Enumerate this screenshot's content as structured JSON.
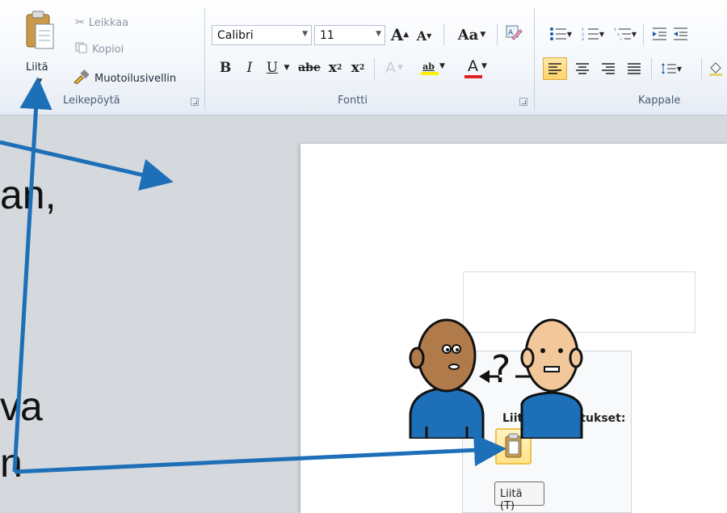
{
  "ribbon": {
    "clipboard": {
      "paste_label": "Liitä",
      "cut_label": "Leikkaa",
      "copy_label": "Kopioi",
      "format_painter_label": "Muotoilusivellin",
      "caption": "Leikepöytä"
    },
    "font": {
      "font_name": "Calibri",
      "font_size": "11",
      "caption": "Fontti",
      "grow_label": "A",
      "shrink_label": "A",
      "case_label": "Aa",
      "bold_label": "B",
      "italic_label": "I",
      "underline_label": "U",
      "strike_label": "abe",
      "subscript_label": "x",
      "superscript_label": "x",
      "effects_label": "A",
      "highlight_label": "ab",
      "color_label": "A"
    },
    "paragraph": {
      "caption": "Kappale"
    }
  },
  "paste_popup": {
    "title": "Liittämisasetukset:",
    "tooltip": "Liitä (T)"
  },
  "slide_text": {
    "fragment_1": "an,",
    "fragment_2": "va",
    "fragment_3": "n"
  },
  "colors": {
    "arrow": "#1d6fb8",
    "font_color_bar": "#e02020",
    "highlight_bar": "#ffee00",
    "skin_left": "#b07a4a",
    "skin_right": "#f2c79a",
    "shirt": "#1d6fb8"
  }
}
